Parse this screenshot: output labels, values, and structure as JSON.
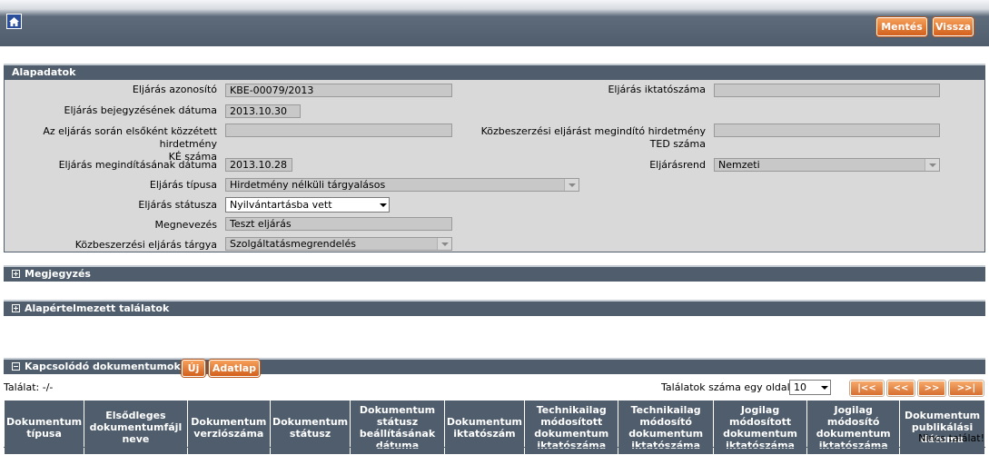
{
  "toolbar": {
    "save_label": "Mentés",
    "back_label": "Vissza"
  },
  "alapadatok": {
    "title": "Alapadatok",
    "eljaras_azonosito": {
      "label": "Eljárás azonosító",
      "value": "KBE-00079/2013"
    },
    "eljaras_iktatoszama": {
      "label": "Eljárás iktatószáma",
      "value": ""
    },
    "bejegyzes_datuma": {
      "label": "Eljárás bejegyzésének dátuma",
      "value": "2013.10.30"
    },
    "ke_szama": {
      "label_line1": "Az eljárás során elsőként közzétett hirdetmény",
      "label_line2": "KÉ száma",
      "value": ""
    },
    "ted_szama": {
      "label_line1": "Közbeszerzési eljárást megindító hirdetmény",
      "label_line2": "TED száma",
      "value": ""
    },
    "megindites_datuma": {
      "label": "Eljárás megindításának dátuma",
      "value": "2013.10.28"
    },
    "eljarasrend": {
      "label": "Eljárásrend",
      "value": "Nemzeti"
    },
    "eljaras_tipusa": {
      "label": "Eljárás típusa",
      "value": "Hirdetmény nélküli tárgyalásos"
    },
    "eljaras_statusza": {
      "label": "Eljárás státusza",
      "value": "Nyilvántartásba vett"
    },
    "megnevezes": {
      "label": "Megnevezés",
      "value": "Teszt eljárás"
    },
    "targya": {
      "label": "Közbeszerzési eljárás tárgya",
      "value": "Szolgáltatásmegrendelés"
    }
  },
  "megjegyzes": {
    "title": "Megjegyzés"
  },
  "alapertelmezett": {
    "title": "Alapértelmezett találatok"
  },
  "kapcsolodo": {
    "title": "Kapcsolódó dokumentumok",
    "new_label": "Új",
    "adatlap_label": "Adatlap",
    "talalat": "Találat: -/-",
    "per_page_label": "Találatok száma egy oldalon",
    "per_page_value": "10",
    "pager": {
      "first": "|<<",
      "prev": "<<",
      "next": ">>",
      "last": ">>|"
    },
    "columns": [
      "Dokumentum típusa",
      "Elsődleges dokumentumfájl neve",
      "Dokumentum verziószáma",
      "Dokumentum státusz",
      "Dokumentum státusz beállításának dátuma",
      "Dokumentum iktatószám",
      "Technikailag módosított dokumentum iktatószáma",
      "Technikailag módosító dokumentum iktatószáma",
      "Jogilag módosított dokumentum iktatószáma",
      "Jogilag módosító dokumentum iktatószáma",
      "Dokumentum publikálási dátuma"
    ],
    "no_result": "Nincs találat!"
  },
  "colors": {
    "header": "#4f5d6c",
    "button": "#e07a30",
    "field": "#c8c8c8",
    "panel": "#d9d9d9"
  }
}
